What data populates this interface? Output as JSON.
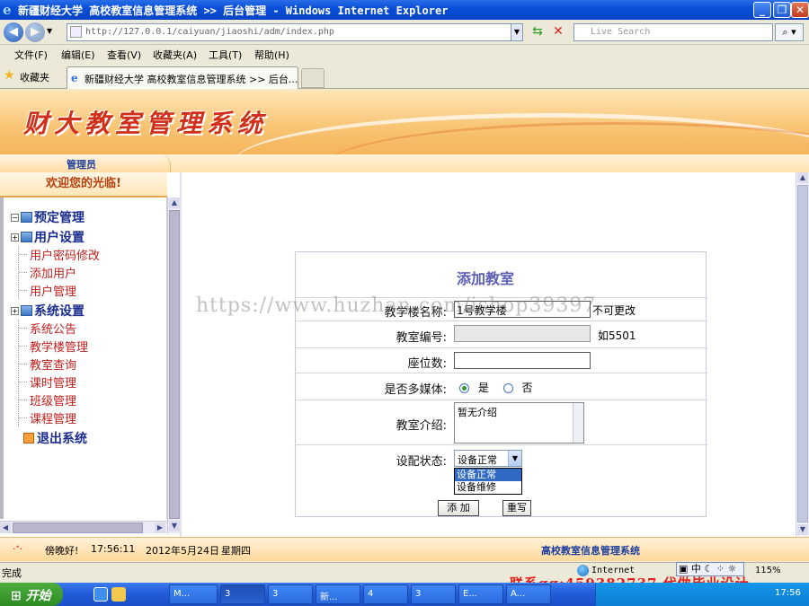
{
  "window": {
    "title": "新疆财经大学 高校教室信息管理系统 >> 后台管理 - Windows Internet Explorer"
  },
  "addressbar": {
    "url": "http://127.0.0.1/caiyuan/jiaoshi/adm/index.php",
    "search_placeholder": "Live Search"
  },
  "menubar": {
    "items": [
      "文件(F)",
      "编辑(E)",
      "查看(V)",
      "收藏夹(A)",
      "工具(T)",
      "帮助(H)"
    ]
  },
  "tabs": {
    "favorites": "收藏夹",
    "active_tab": "新疆财经大学 高校教室信息管理系统 >> 后台..."
  },
  "banner": {
    "title": "财大教室管理系统"
  },
  "sidebar": {
    "role": "管理员",
    "welcome": "欢迎您的光临!",
    "groups": [
      {
        "label": "预定管理",
        "items": []
      },
      {
        "label": "用户设置",
        "items": [
          "用户密码修改",
          "添加用户",
          "用户管理"
        ]
      },
      {
        "label": "系统设置",
        "items": [
          "系统公告",
          "教学楼管理",
          "教室查询",
          "课时管理",
          "班级管理",
          "课程管理"
        ]
      }
    ],
    "exit": "退出系统"
  },
  "form": {
    "title": "添加教室",
    "building_label": "教学楼名称:",
    "building_value": "1号教学楼",
    "building_note": "不可更改",
    "room_label": "教室编号:",
    "room_value": "",
    "room_note": "如5501",
    "seats_label": "座位数:",
    "seats_value": "",
    "media_label": "是否多媒体:",
    "media_yes": "是",
    "media_no": "否",
    "media_selected": "是",
    "intro_label": "教室介绍:",
    "intro_value": "暂无介绍",
    "status_label": "设配状态:",
    "status_value": "设备正常",
    "status_options": [
      "设备正常",
      "设备维修"
    ],
    "submit_label": "添 加",
    "reset_label": "重写"
  },
  "watermark": "https://www.huzhan.com/ishop39397",
  "footer": {
    "greeting": "傍晚好!",
    "time": "17:56:11",
    "date": "2012年5月24日",
    "weekday": "星期四",
    "system_name": "高校教室信息管理系统"
  },
  "statusbar": {
    "status": "完成",
    "zone": "Internet",
    "zoom": "115%",
    "ime": "中",
    "contact": "联系qq:459382737 代做毕业设计"
  },
  "taskbar": {
    "start": "开始",
    "tasks": [
      "M...",
      "3",
      "3",
      "新...",
      "4",
      "3",
      "E...",
      "A..."
    ],
    "clock": "17:56"
  },
  "colors": {
    "accent": "#1b2d8f",
    "link_red": "#c0201c",
    "title_purple": "#5d5fb6",
    "banner_orange": "#f6b45a"
  }
}
